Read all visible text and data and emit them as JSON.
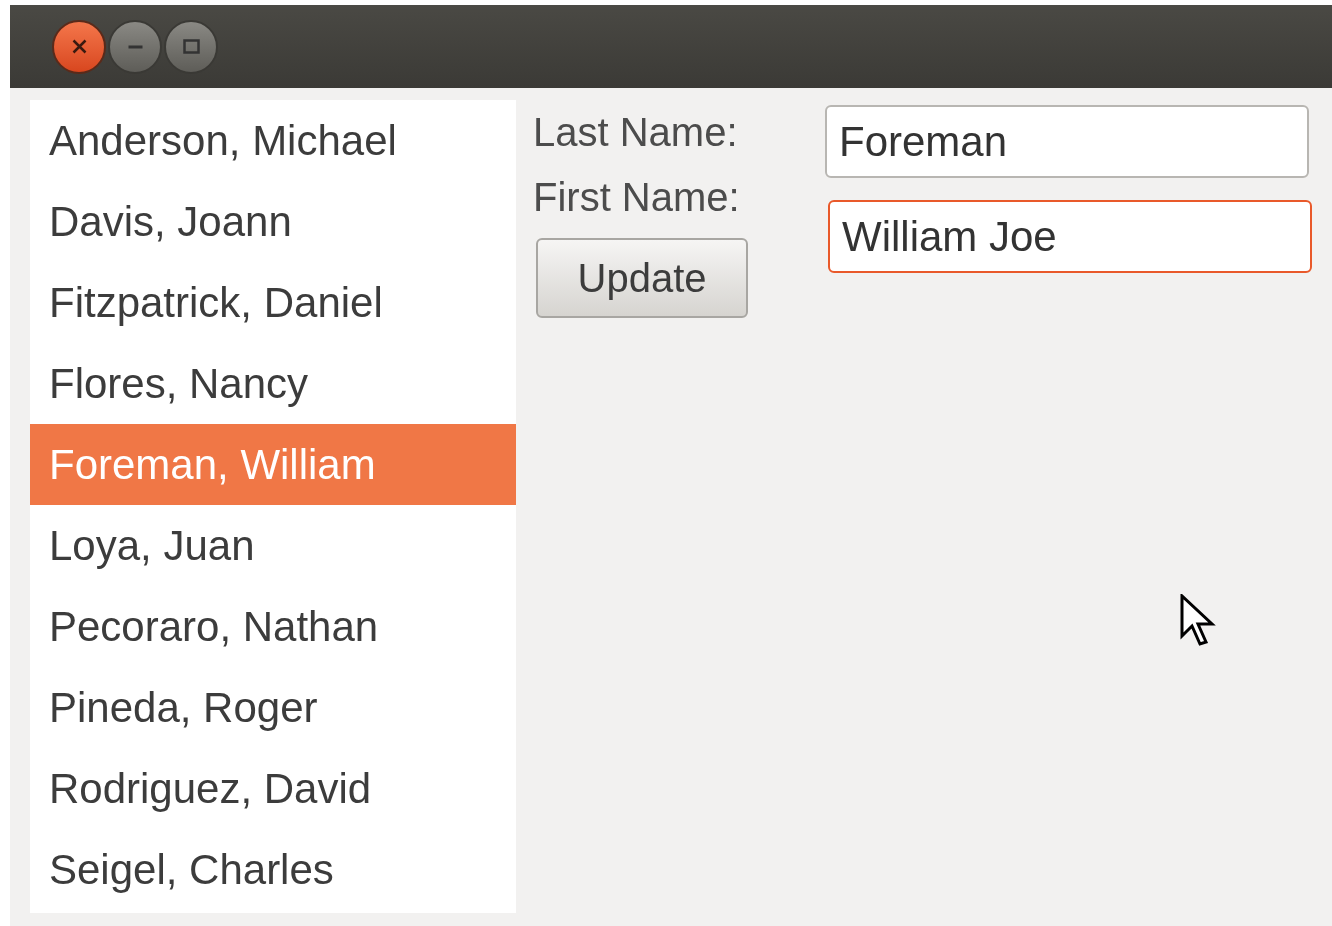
{
  "list": {
    "items": [
      {
        "label": "Anderson, Michael",
        "selected": false
      },
      {
        "label": "Davis, Joann",
        "selected": false
      },
      {
        "label": "Fitzpatrick, Daniel",
        "selected": false
      },
      {
        "label": "Flores, Nancy",
        "selected": false
      },
      {
        "label": "Foreman, William",
        "selected": true
      },
      {
        "label": "Loya, Juan",
        "selected": false
      },
      {
        "label": "Pecoraro, Nathan",
        "selected": false
      },
      {
        "label": "Pineda, Roger",
        "selected": false
      },
      {
        "label": "Rodriguez, David",
        "selected": false
      },
      {
        "label": "Seigel, Charles",
        "selected": false
      }
    ]
  },
  "form": {
    "fields": [
      {
        "label": "Last Name:",
        "value": "Foreman",
        "focused": false
      },
      {
        "label": "First Name:",
        "value": "William Joe",
        "focused": true
      }
    ],
    "button": "Update"
  }
}
